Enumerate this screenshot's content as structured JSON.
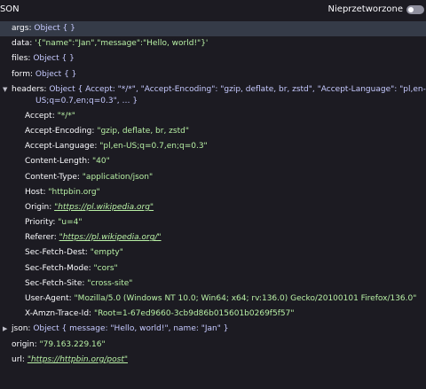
{
  "header": {
    "title": "JSON",
    "raw_toggle_label": "Nieprzetworzone"
  },
  "rows": {
    "args": {
      "key": "args",
      "value": "Object {  }"
    },
    "data": {
      "key": "data",
      "value": "'{\"name\":\"Jan\",\"message\":\"Hello, world!\"}'"
    },
    "files": {
      "key": "files",
      "value": "Object {  }"
    },
    "form": {
      "key": "form",
      "value": "Object {  }"
    },
    "headers": {
      "key": "headers",
      "value_line1": "Object { Accept: \"*/*\", \"Accept-Encoding\": \"gzip, deflate, br, zstd\", \"Accept-Language\": \"pl,en-",
      "value_line2": "US;q=0.7,en;q=0.3\", … }"
    },
    "accept": {
      "key": "Accept",
      "value": "\"*/*\""
    },
    "accept_encoding": {
      "key": "Accept-Encoding",
      "value": "\"gzip, deflate, br, zstd\""
    },
    "accept_language": {
      "key": "Accept-Language",
      "value": "\"pl,en-US;q=0.7,en;q=0.3\""
    },
    "content_length": {
      "key": "Content-Length",
      "value": "\"40\""
    },
    "content_type": {
      "key": "Content-Type",
      "value": "\"application/json\""
    },
    "host": {
      "key": "Host",
      "value": "\"httpbin.org\""
    },
    "origin_header": {
      "key": "Origin",
      "value": "\"https://pl.wikipedia.org\""
    },
    "priority": {
      "key": "Priority",
      "value": "\"u=4\""
    },
    "referer": {
      "key": "Referer",
      "value": "\"https://pl.wikipedia.org/\""
    },
    "sec_fetch_dest": {
      "key": "Sec-Fetch-Dest",
      "value": "\"empty\""
    },
    "sec_fetch_mode": {
      "key": "Sec-Fetch-Mode",
      "value": "\"cors\""
    },
    "sec_fetch_site": {
      "key": "Sec-Fetch-Site",
      "value": "\"cross-site\""
    },
    "user_agent": {
      "key": "User-Agent",
      "value": "\"Mozilla/5.0 (Windows NT 10.0; Win64; x64; rv:136.0) Gecko/20100101 Firefox/136.0\""
    },
    "trace_id": {
      "key": "X-Amzn-Trace-Id",
      "value": "\"Root=1-67ed9660-3cb9d86b015601b0269f5f57\""
    },
    "json": {
      "key": "json",
      "value": "Object { message: \"Hello, world!\", name: \"Jan\" }"
    },
    "origin": {
      "key": "origin",
      "value": "\"79.163.229.16\""
    },
    "url": {
      "key": "url",
      "value": "\"https://httpbin.org/post\""
    }
  },
  "colors": {
    "background": "#1c1b22",
    "selected_row": "#353b48",
    "string_value": "#b8f0a5",
    "object_value": "#c6caff"
  }
}
